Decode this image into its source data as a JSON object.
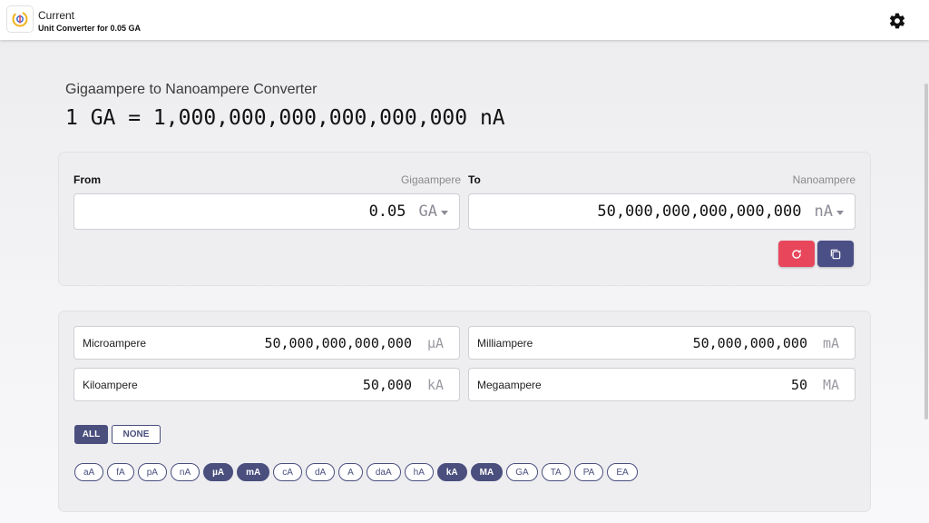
{
  "header": {
    "title": "Current",
    "subtitle": "Unit Converter for 0.05 GA"
  },
  "converter": {
    "title": "Gigaampere to Nanoampere Converter",
    "formula": "1 GA = 1,000,000,000,000,000,000 nA",
    "from": {
      "label": "From",
      "unit_name": "Gigaampere",
      "value": "0.05",
      "unit": "GA"
    },
    "to": {
      "label": "To",
      "unit_name": "Nanoampere",
      "value": "50,000,000,000,000,000",
      "unit": "nA"
    }
  },
  "results": [
    {
      "name": "Microampere",
      "value": "50,000,000,000,000",
      "symbol": "µA"
    },
    {
      "name": "Milliampere",
      "value": "50,000,000,000",
      "symbol": "mA"
    },
    {
      "name": "Kiloampere",
      "value": "50,000",
      "symbol": "kA"
    },
    {
      "name": "Megaampere",
      "value": "50",
      "symbol": "MA"
    }
  ],
  "toggles": {
    "all": "ALL",
    "none": "NONE"
  },
  "chips": [
    {
      "label": "aA",
      "on": false
    },
    {
      "label": "fA",
      "on": false
    },
    {
      "label": "pA",
      "on": false
    },
    {
      "label": "nA",
      "on": false
    },
    {
      "label": "µA",
      "on": true
    },
    {
      "label": "mA",
      "on": true
    },
    {
      "label": "cA",
      "on": false
    },
    {
      "label": "dA",
      "on": false
    },
    {
      "label": "A",
      "on": false
    },
    {
      "label": "daA",
      "on": false
    },
    {
      "label": "hA",
      "on": false
    },
    {
      "label": "kA",
      "on": true
    },
    {
      "label": "MA",
      "on": true
    },
    {
      "label": "GA",
      "on": false
    },
    {
      "label": "TA",
      "on": false
    },
    {
      "label": "PA",
      "on": false
    },
    {
      "label": "EA",
      "on": false
    }
  ],
  "colors": {
    "accent": "#4a4f7e",
    "reset": "#e8475b",
    "copy": "#4a4f86"
  },
  "icons": {
    "logo": "current-logo-icon",
    "settings": "gear-icon",
    "reset": "refresh-icon",
    "copy": "copy-icon"
  }
}
